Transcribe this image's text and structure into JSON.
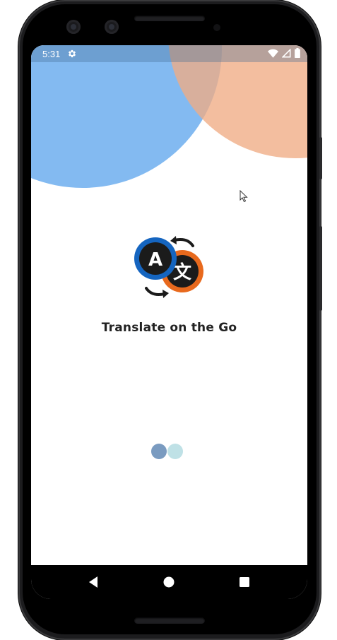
{
  "status_bar": {
    "time": "5:31",
    "icons": [
      "settings-gear-icon",
      "wifi-icon",
      "cellular-signal-icon",
      "battery-icon"
    ]
  },
  "app": {
    "title": "Translate on the Go",
    "logo": {
      "primary_letter": "A",
      "secondary_glyph": "文",
      "primary_color": "#1565c0",
      "secondary_color": "#e8691d"
    }
  },
  "loading_indicator": {
    "dot_colors": [
      "#7a9bc0",
      "#bfe1e6"
    ]
  },
  "navigation": {
    "buttons": [
      "back-icon",
      "home-icon",
      "recents-icon"
    ]
  },
  "colors": {
    "circle_blue": "#78b4f0",
    "circle_orange": "#f0ac84",
    "title_text": "#222222"
  }
}
